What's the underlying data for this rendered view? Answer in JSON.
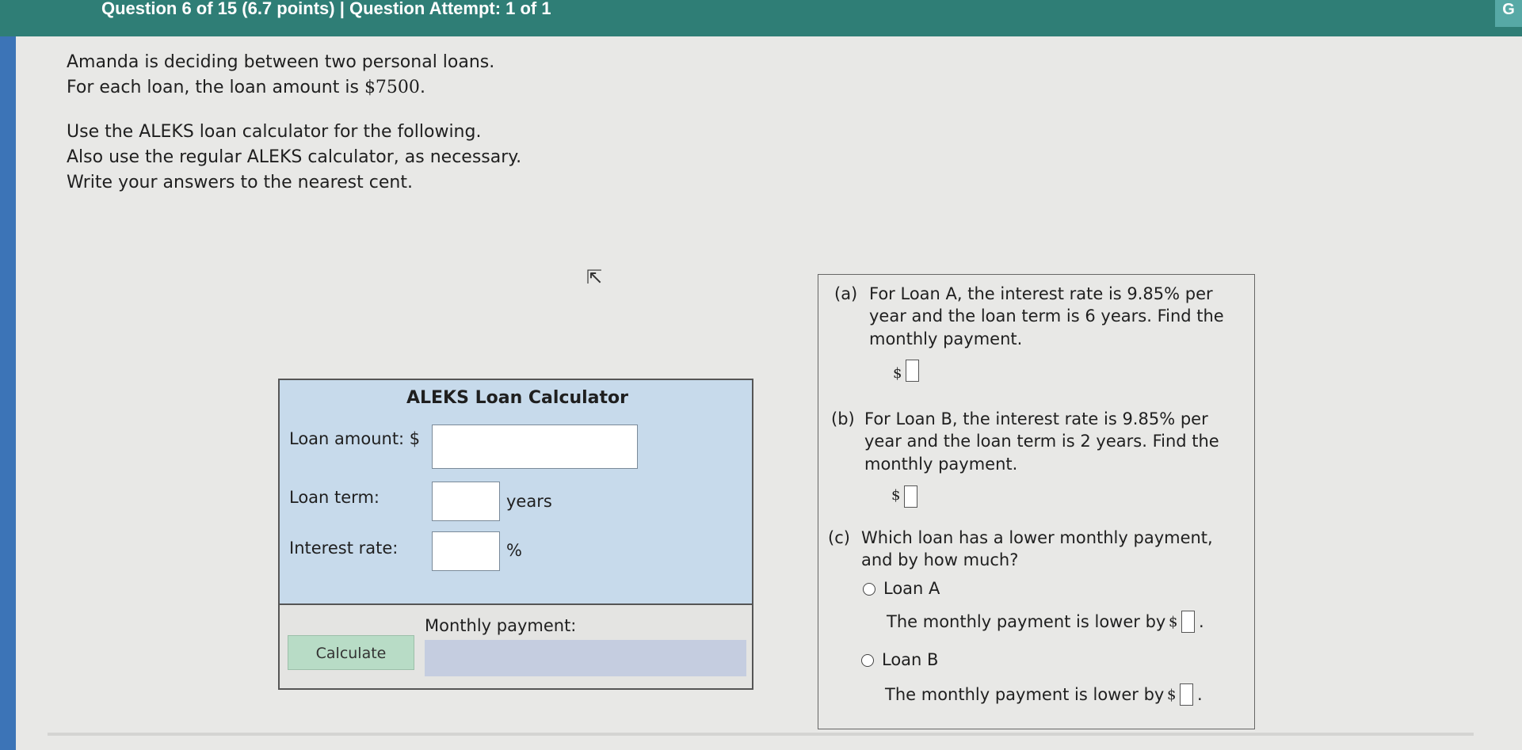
{
  "header": {
    "question_info": "Question 6 of 15 (6.7 points)  |  Question Attempt: 1 of 1",
    "corner_letter": "G"
  },
  "prompt": {
    "line1": "Amanda is deciding between two personal loans.",
    "line2_prefix": "For each loan, the loan amount is ",
    "line2_amount": "$7500",
    "line2_suffix": ".",
    "line3": "Use the ALEKS loan calculator for the following.",
    "line4": "Also use the regular ALEKS calculator, as necessary.",
    "line5": "Write your answers to the nearest cent."
  },
  "calculator": {
    "title": "ALEKS Loan Calculator",
    "loan_amount_label": "Loan amount: $",
    "loan_term_label": "Loan term:",
    "loan_term_unit": "years",
    "interest_rate_label": "Interest rate:",
    "interest_rate_unit": "%",
    "monthly_payment_label": "Monthly payment:",
    "calculate_label": "Calculate"
  },
  "answers": {
    "a_label": "(a)",
    "a_text": "For Loan A, the interest rate is 9.85% per year and the loan term is 6 years. Find the monthly payment.",
    "b_label": "(b)",
    "b_text": "For Loan B, the interest rate is 9.85% per year and the loan term is 2 years. Find the monthly payment.",
    "c_label": "(c)",
    "c_text": "Which loan has a lower monthly payment, and by how much?",
    "dollar_sign": "$",
    "option_a": "Loan A",
    "option_b": "Loan B",
    "lower_text": "The monthly payment is lower by",
    "period": "."
  }
}
